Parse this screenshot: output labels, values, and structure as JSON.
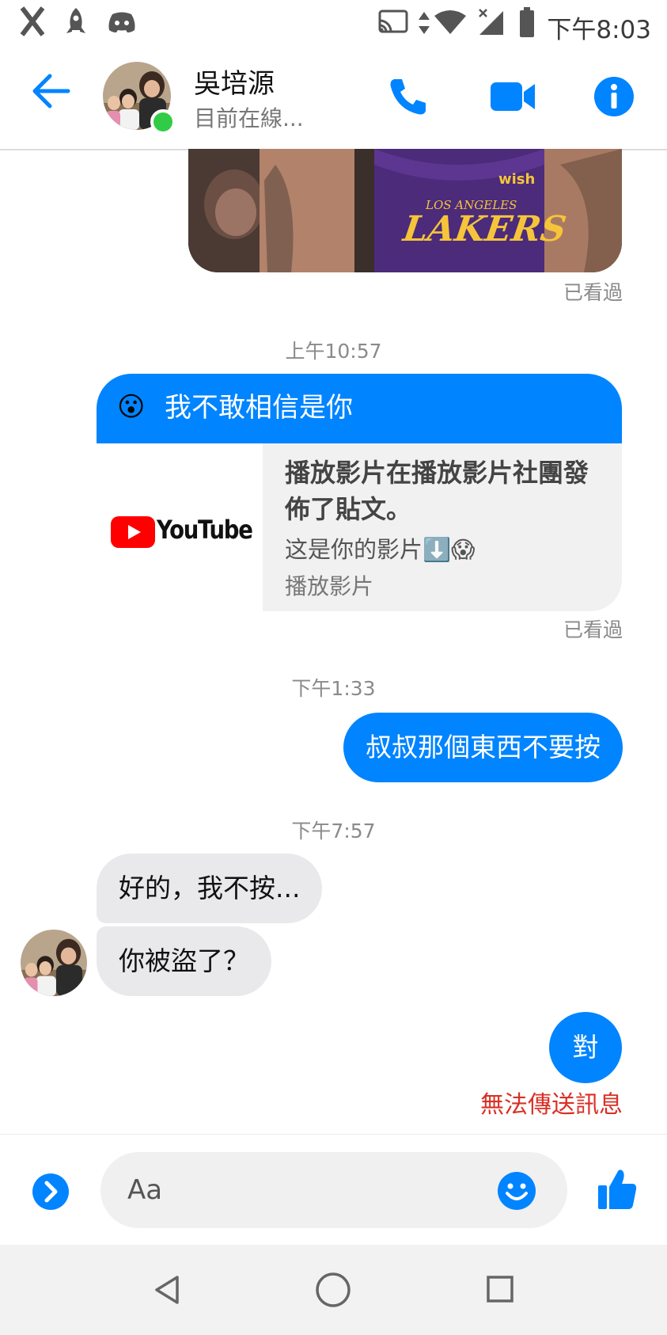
{
  "status_bar": {
    "time": "下午8:03"
  },
  "header": {
    "contact_name": "吳培源",
    "contact_status": "目前在線..."
  },
  "image_message": {
    "seen_label": "已看過",
    "jersey_team": "LAKERS",
    "jersey_city": "LOS ANGELES",
    "jersey_sponsor": "wish"
  },
  "messages": {
    "ts1": "上午10:57",
    "m1_emoji": "😮",
    "m1_text": "我不敢相信是你",
    "link_title": "播放影片在播放影片社團發佈了貼文。",
    "link_desc": "这是你的影片⬇️😱",
    "link_source": "播放影片",
    "link_logo_text": "YouTube",
    "seen2": "已看過",
    "ts2": "下午1:33",
    "m2_text": "叔叔那個東西不要按",
    "ts3": "下午7:57",
    "m3_text": "好的，我不按...",
    "m4_text": "你被盜了？",
    "m5_text": "對",
    "error_text": "無法傳送訊息"
  },
  "composer": {
    "placeholder": "Aa"
  },
  "colors": {
    "accent": "#0084ff",
    "error": "#d93025",
    "online": "#31cc46"
  }
}
